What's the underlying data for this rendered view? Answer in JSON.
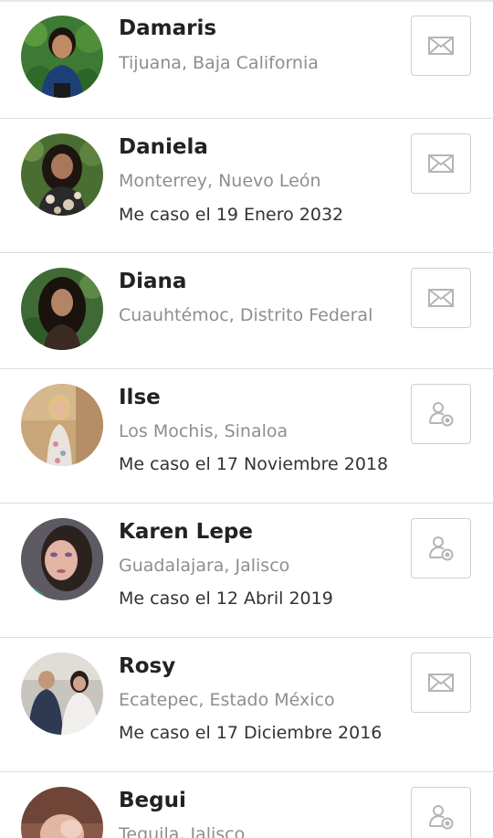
{
  "contacts": [
    {
      "name": "Damaris",
      "location": "Tijuana, Baja California",
      "wedding": "",
      "action": "message-icon"
    },
    {
      "name": "Daniela",
      "location": "Monterrey, Nuevo León",
      "wedding": "Me caso el 19 Enero 2032",
      "action": "message-icon"
    },
    {
      "name": "Diana",
      "location": "Cuauhtémoc, Distrito Federal",
      "wedding": "",
      "action": "message-icon"
    },
    {
      "name": "Ilse",
      "location": "Los Mochis, Sinaloa",
      "wedding": "Me caso el 17 Noviembre 2018",
      "action": "add-friend-icon"
    },
    {
      "name": "Karen Lepe",
      "location": "Guadalajara, Jalisco",
      "wedding": "Me caso el 12 Abril 2019",
      "action": "add-friend-icon"
    },
    {
      "name": "Rosy",
      "location": "Ecatepec, Estado México",
      "wedding": "Me caso el 17 Diciembre 2016",
      "action": "message-icon"
    },
    {
      "name": "Begui",
      "location": "Tequila, Jalisco",
      "wedding": "",
      "action": "add-friend-icon"
    }
  ],
  "colors": {
    "name": "#222222",
    "location": "#8e8e8e",
    "wedding": "#333333",
    "icon": "#b5b5b5",
    "border": "#dddddd"
  }
}
